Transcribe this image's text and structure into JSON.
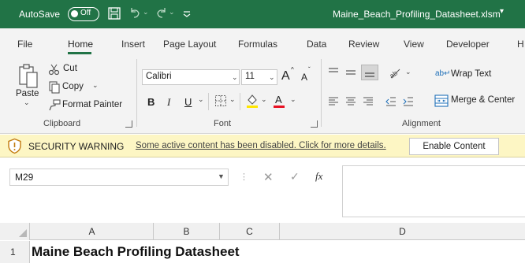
{
  "titlebar": {
    "autosave_label": "AutoSave",
    "autosave_state": "Off",
    "document_title": "Maine_Beach_Profiling_Datasheet.xlsm",
    "title_caret": "▾",
    "accent_color": "#217346"
  },
  "menu_tabs": [
    "File",
    "Home",
    "Insert",
    "Page Layout",
    "Formulas",
    "Data",
    "Review",
    "View",
    "Developer",
    "H"
  ],
  "active_tab": "Home",
  "ribbon": {
    "clipboard": {
      "paste_label": "Paste",
      "paste_caret": "⌄",
      "cut_label": "Cut",
      "copy_label": "Copy",
      "copy_caret": "⌄",
      "format_painter_label": "Format Painter",
      "group_label": "Clipboard"
    },
    "font": {
      "font_name": "Calibri",
      "font_size": "11",
      "grow_label": "A",
      "shrink_label": "A",
      "bold_label": "B",
      "italic_label": "I",
      "underline_label": "U",
      "dropdown_caret": "⌄",
      "font_color_hex": "#e81123",
      "highlight_color_hex": "#ffe600",
      "group_label": "Font"
    },
    "alignment": {
      "wrap_text_label": "Wrap Text",
      "merge_center_label": "Merge & Center",
      "group_label": "Alignment"
    }
  },
  "security_bar": {
    "title": "SECURITY WARNING",
    "message": "Some active content has been disabled. Click for more details.",
    "enable_button": "Enable Content",
    "background_color": "#fdf6c4"
  },
  "formula_bar": {
    "name_box_value": "M29",
    "cancel_glyph": "✕",
    "enter_glyph": "✓",
    "fx_label": "fx",
    "formula_value": ""
  },
  "sheet": {
    "column_headers": [
      "A",
      "B",
      "C",
      "D"
    ],
    "row_headers": [
      "1"
    ],
    "cells": {
      "A1": "Maine Beach Profiling Datasheet"
    }
  }
}
